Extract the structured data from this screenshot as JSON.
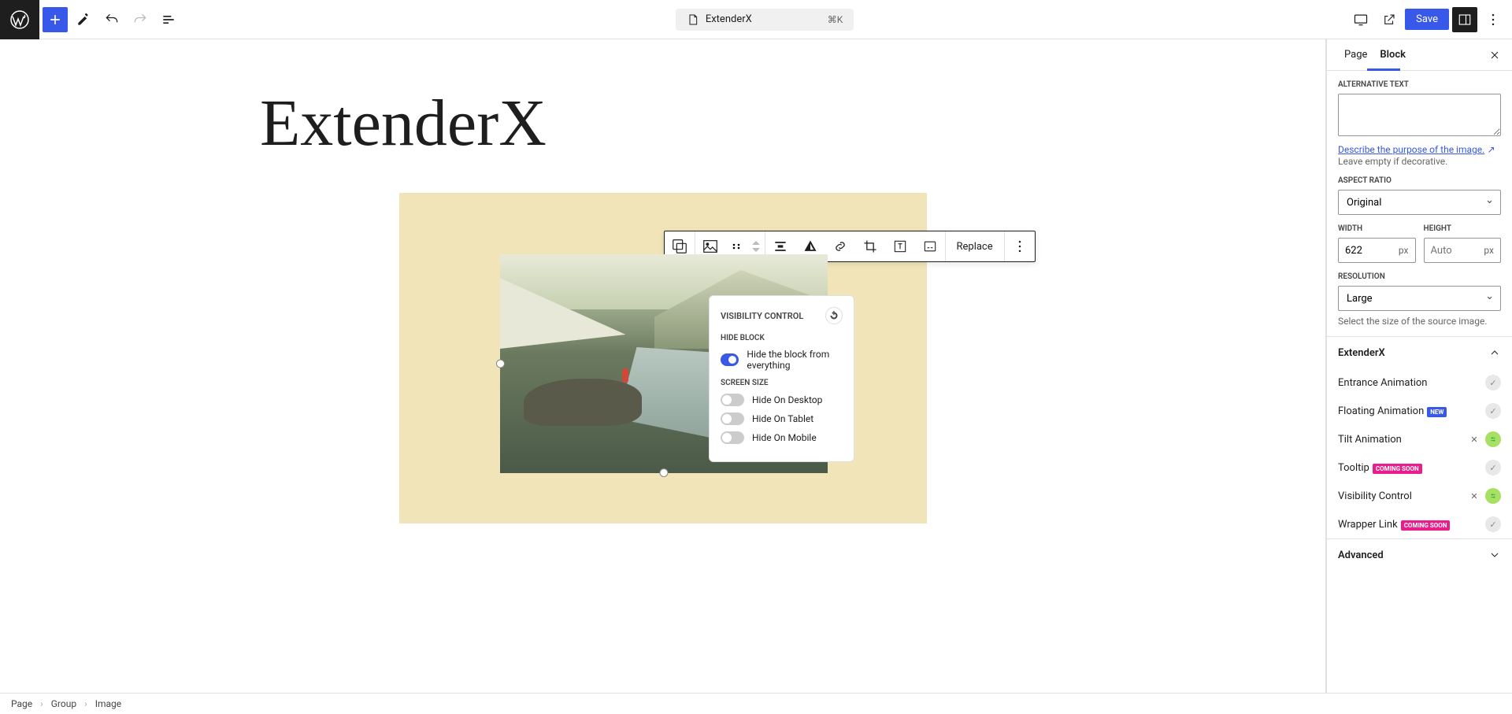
{
  "topbar": {
    "doc_title": "ExtenderX",
    "kbd": "⌘K",
    "save": "Save"
  },
  "page_title": "ExtenderX",
  "toolbar": {
    "replace": "Replace"
  },
  "float": {
    "title": "VISIBILITY CONTROL",
    "hide_block_lbl": "HIDE BLOCK",
    "hide_all": "Hide the block from everything",
    "screen_lbl": "SCREEN SIZE",
    "hide_desktop": "Hide On Desktop",
    "hide_tablet": "Hide On Tablet",
    "hide_mobile": "Hide On Mobile"
  },
  "sidebar": {
    "tab_page": "Page",
    "tab_block": "Block",
    "alt_lbl": "ALTERNATIVE TEXT",
    "alt_link": "Describe the purpose of the image.",
    "alt_link_icon": "↗",
    "alt_hint": "Leave empty if decorative.",
    "ar_lbl": "ASPECT RATIO",
    "ar_val": "Original",
    "w_lbl": "WIDTH",
    "w_val": "622",
    "h_lbl": "HEIGHT",
    "h_ph": "Auto",
    "unit": "px",
    "res_lbl": "RESOLUTION",
    "res_val": "Large",
    "res_hint": "Select the size of the source image.",
    "ext_title": "ExtenderX",
    "ext_entrance": "Entrance Animation",
    "ext_floating": "Floating Animation",
    "ext_tilt": "Tilt Animation",
    "ext_tooltip": "Tooltip",
    "ext_vis": "Visibility Control",
    "ext_wrap": "Wrapper Link",
    "badge_new": "NEW",
    "badge_cs": "COMING SOON",
    "adv_title": "Advanced"
  },
  "breadcrumb": {
    "a": "Page",
    "b": "Group",
    "c": "Image"
  }
}
